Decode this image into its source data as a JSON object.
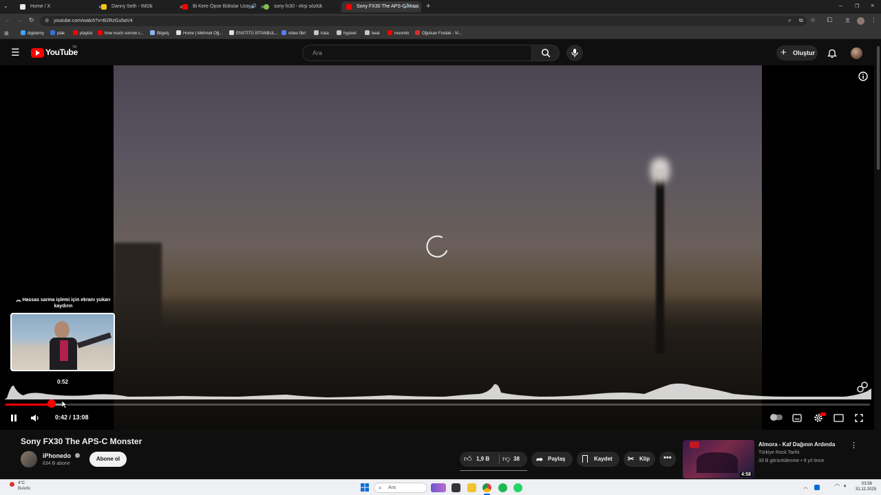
{
  "browser": {
    "tabs": [
      {
        "title": "Home / X",
        "favicon_color": "#e7e9ea"
      },
      {
        "title": "Danny Seth - IMDb",
        "favicon_color": "#f5c518"
      },
      {
        "title": "Bi Kere Öpse Bükslar Uzay",
        "favicon_color": "#ff0000"
      },
      {
        "title": "sony fx30 - ekşi sözlük",
        "favicon_color": "#81c14b"
      },
      {
        "title": "Sony FX30 The APS-C Mons",
        "favicon_color": "#ff0000"
      }
    ],
    "url": "youtube.com/watch?v=B2RzGu5aV4",
    "bookmarks": [
      {
        "label": "digidemy",
        "icon_color": "#3ea6ff"
      },
      {
        "label": "plak",
        "icon_color": "#3a6fd8"
      },
      {
        "label": "playlist",
        "icon_color": "#ff0000"
      },
      {
        "label": "how much sorrow c...",
        "icon_color": "#ff0000"
      },
      {
        "label": "Bilgelş",
        "icon_color": "#8ab4f8"
      },
      {
        "label": "Home | Mehmet Oğ...",
        "icon_color": "#e0e0e0"
      },
      {
        "label": "ENSTİTÜ İSTANBUL...",
        "icon_color": "#e0e0e0"
      },
      {
        "label": "video fikri",
        "icon_color": "#5b7cfa"
      },
      {
        "label": "hata",
        "icon_color": "#c7c7c7"
      },
      {
        "label": "hypixel",
        "icon_color": "#c7c7c7"
      },
      {
        "label": "beat",
        "icon_color": "#c7c7c7"
      },
      {
        "label": "moomin",
        "icon_color": "#ff0000"
      },
      {
        "label": "Oğulcan Fındak - Vi...",
        "icon_color": "#d32f2f"
      }
    ]
  },
  "masthead": {
    "logo_text": "YouTube",
    "country_code": "TR",
    "search_placeholder": "Ara",
    "create_label": "Oluştur"
  },
  "player": {
    "seek_hint": "Hassas sarma işlemi için ekranı yukarı kaydırın",
    "preview_time": "0:52",
    "current_time": "0:42",
    "duration": "13:08",
    "time_display": "0:42 / 13:08",
    "played_fraction": 0.053,
    "buffered_fraction": 0.066,
    "accent": "#ff0000"
  },
  "video": {
    "title": "Sony FX30 The APS-C Monster",
    "channel": "iPhonedo",
    "subscribers": "634 B abone",
    "subscribe_label": "Abone ol",
    "likes": "1,9 B",
    "dislikes": "38",
    "share_label": "Paylaş",
    "save_label": "Kaydet",
    "clip_label": "Klip"
  },
  "recommendation": {
    "title": "Almora - Kaf Dağının Ardında",
    "channel": "Türkiye Rock Tarihi",
    "meta": "33 B görüntülenme • 9 yıl önce",
    "duration": "4:58"
  },
  "taskbar": {
    "search_placeholder": "Ara",
    "weather_temp": "4°C",
    "weather_desc": "Bulutlu",
    "time": "03:56",
    "date": "31.12.2025"
  }
}
